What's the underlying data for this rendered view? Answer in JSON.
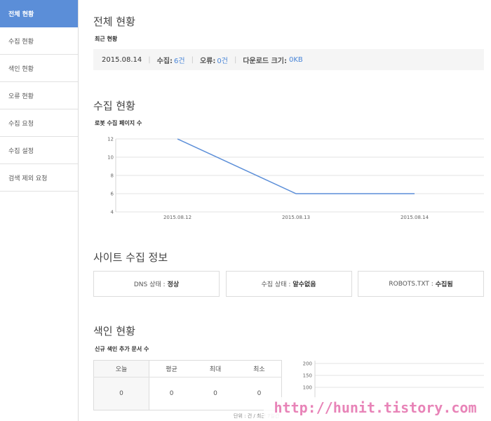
{
  "sidebar": {
    "items": [
      {
        "label": "전체 현황",
        "active": true
      },
      {
        "label": "수집 현황"
      },
      {
        "label": "색인 현황"
      },
      {
        "label": "오류 현황"
      },
      {
        "label": "수집 요청"
      },
      {
        "label": "수집 설정"
      },
      {
        "label": "검색 제외 요청"
      }
    ]
  },
  "overview": {
    "title": "전체 현황",
    "subtitle": "최근 현황",
    "date": "2015.08.14",
    "collect_label": "수집:",
    "collect_value": "6건",
    "error_label": "오류:",
    "error_value": "0건",
    "download_label": "다운로드 크기:",
    "download_value": "0KB"
  },
  "crawl": {
    "title": "수집 현황",
    "subtitle": "로봇 수집 페이지 수"
  },
  "chart_data": [
    {
      "type": "line",
      "x": [
        "2015.08.12",
        "2015.08.13",
        "2015.08.14"
      ],
      "series": [
        {
          "values": [
            12,
            6,
            6
          ]
        }
      ],
      "yticks": [
        4,
        6,
        8,
        10,
        12
      ],
      "ylim": [
        4,
        12
      ],
      "grid": true,
      "color": "#5b8ed8"
    },
    {
      "type": "line",
      "yticks": [
        100,
        150,
        200
      ],
      "grid": true
    }
  ],
  "site_info": {
    "title": "사이트 수집 정보",
    "dns_label": "DNS 상태 :",
    "dns_value": "정상",
    "crawl_label": "수집 상태 :",
    "crawl_value": "알수없음",
    "robots_label": "ROBOTS.TXT :",
    "robots_value": "수집됨"
  },
  "index": {
    "title": "색인 현황",
    "subtitle": "신규 색인 추가 문서 수",
    "headers": [
      "오늘",
      "평균",
      "최대",
      "최소"
    ],
    "values": [
      "0",
      "0",
      "0",
      "0"
    ],
    "unit": "단위 : 건 / 최근 7일간"
  },
  "watermark": "http://hunit.tistory.com"
}
